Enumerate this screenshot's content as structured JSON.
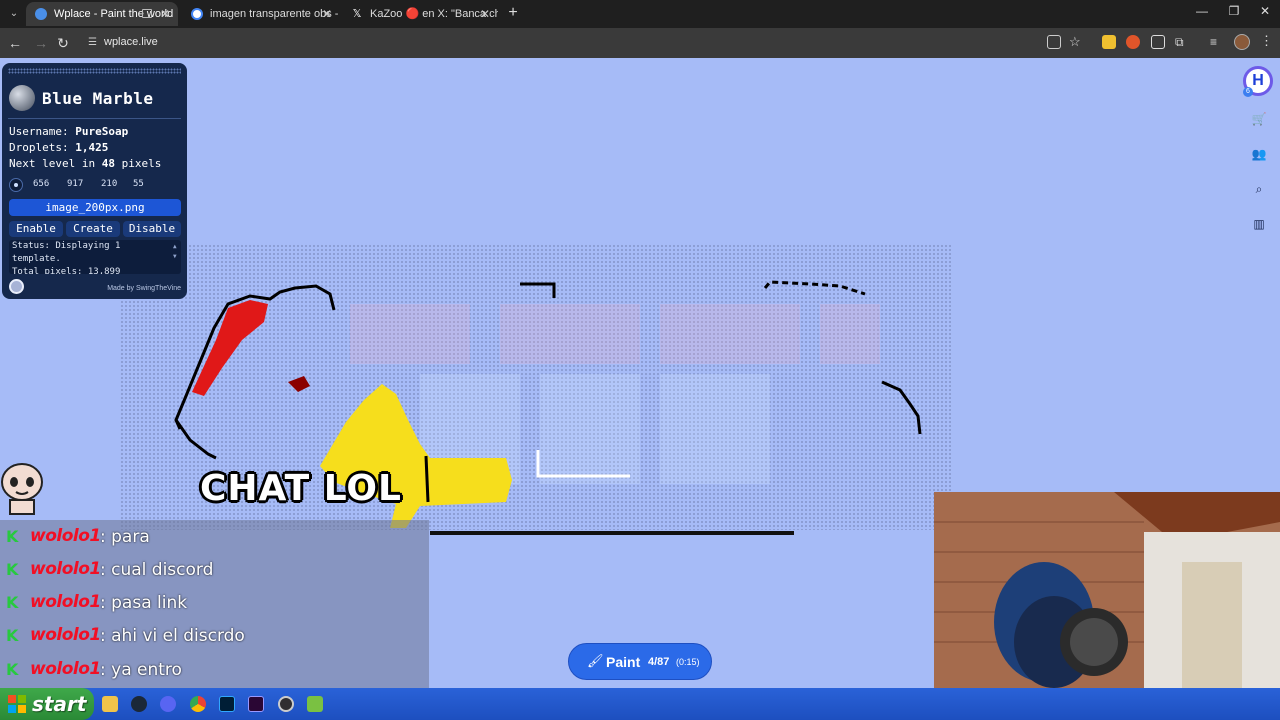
{
  "browser": {
    "tabs": [
      {
        "title": "Wplace - Paint the world",
        "active": true
      },
      {
        "title": "imagen transparente obs - Busc",
        "active": false
      },
      {
        "title": "KaZoo 🔴 en X: \"Banca chat? h",
        "active": false
      }
    ],
    "url": "wplace.live"
  },
  "blue_marble": {
    "title": "Blue Marble",
    "username_label": "Username:",
    "username": "PureSoap",
    "droplets_label": "Droplets:",
    "droplets": "1,425",
    "next_level_prefix": "Next level in",
    "next_level_value": "48",
    "next_level_suffix": "pixels",
    "coords": [
      "656",
      "917",
      "210",
      "55"
    ],
    "file": "image_200px.png",
    "buttons": {
      "enable": "Enable",
      "create": "Create",
      "disable": "Disable"
    },
    "status_lines": [
      "Status: Displaying 1",
      "template.",
      "Total pixels: 13,899"
    ],
    "credit": "Made by SwingTheVine"
  },
  "wplace": {
    "paint_label": "Paint",
    "paint_count": "4/87",
    "paint_time": "(0:15)",
    "avatar_letter": "H",
    "avatar_badge": "6",
    "tools": [
      "shop-icon",
      "people-icon",
      "search-location-icon",
      "leaderboard-icon"
    ]
  },
  "stream": {
    "banner": "CHAT LOL",
    "chat": [
      {
        "user": "wololo1",
        "message": ": para"
      },
      {
        "user": "wololo1",
        "message": ": cual discord"
      },
      {
        "user": "wololo1",
        "message": ": pasa link"
      },
      {
        "user": "wololo1",
        "message": ": ahi vi el discrdo"
      },
      {
        "user": "wololo1",
        "message": ": ya entro"
      }
    ]
  },
  "taskbar": {
    "start_label": "start",
    "apps": [
      "folder-icon",
      "steam-icon",
      "discord-icon",
      "chrome-icon",
      "photoshop-icon",
      "premiere-icon",
      "obs-icon",
      "app-icon"
    ]
  },
  "colors": {
    "map_bg": "#a6bbf7",
    "panel_bg": "#15284c",
    "paint_button": "#2b6ae8",
    "chat_username": "#f20f24",
    "taskbar": "#2a62d8",
    "start_button": "#3fa84a"
  }
}
